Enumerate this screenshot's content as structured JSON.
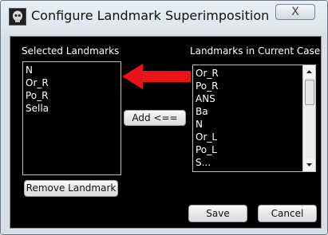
{
  "window": {
    "title": "Configure Landmark Superimposition",
    "close_glyph": "X",
    "app_icon": "skull-icon"
  },
  "selected": {
    "label": "Selected Landmarks",
    "items": [
      "N",
      "Or_R",
      "Po_R",
      "Sella"
    ]
  },
  "current": {
    "label": "Landmarks in Current Case",
    "items": [
      "Or_R",
      "Po_R",
      "ANS",
      "Ba",
      "N",
      "Or_L",
      "Po_L",
      "S..."
    ]
  },
  "buttons": {
    "add": "Add <==",
    "remove": "Remove Landmark",
    "save": "Save",
    "cancel": "Cancel"
  },
  "colors": {
    "client_bg": "#000000",
    "arrow": "#e8141a"
  }
}
